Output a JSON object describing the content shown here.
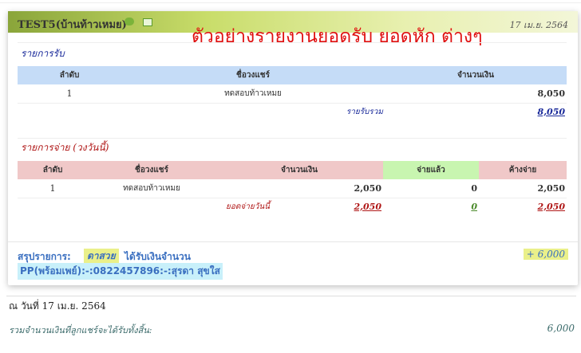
{
  "header": {
    "title": "TEST5(บ้านท้าวเหมย)",
    "date": "17 เม.ย. 2564",
    "annotation": "ตัวอย่างรายงานยอดรับ ยอดหัก ต่างๆ"
  },
  "receipts": {
    "title": "รายการรับ",
    "columns": [
      "ลำดับ",
      "ชื่อวงแชร์",
      "จำนวนเงิน"
    ],
    "rows": [
      {
        "no": "1",
        "name": "ทดสอบท้าวเหมย",
        "amount": "8,050"
      }
    ],
    "total_label": "รายรับรวม",
    "total": "8,050"
  },
  "payments": {
    "title": "รายการจ่าย (วงวันนี้)",
    "columns": [
      "ลำดับ",
      "ชื่อวงแชร์",
      "จำนวนเงิน",
      "จ่ายแล้ว",
      "ค้างจ่าย"
    ],
    "rows": [
      {
        "no": "1",
        "name": "ทดสอบท้าวเหมย",
        "amount": "2,050",
        "paid": "0",
        "due": "2,050"
      }
    ],
    "total_label": "ยอดจ่ายวันนี้",
    "total_amount": "2,050",
    "total_paid": "0",
    "total_due": "2,050"
  },
  "summary": {
    "label": "สรุปรายการ:",
    "member": "ดาสวย",
    "text": "ได้รับเงินจำนวน",
    "amount": "+ 6,000",
    "promptpay": "PP(พร้อมเพย์):-:0822457896:-:สุรดา สุขใส"
  },
  "footer": {
    "date_line": "ณ วันที่ 17 เม.ย. 2564",
    "grand_label": "รวมจำนวนเงินที่ลูกแชร์จะได้รับทั้งสิ้น:",
    "grand_total": "6,000"
  }
}
